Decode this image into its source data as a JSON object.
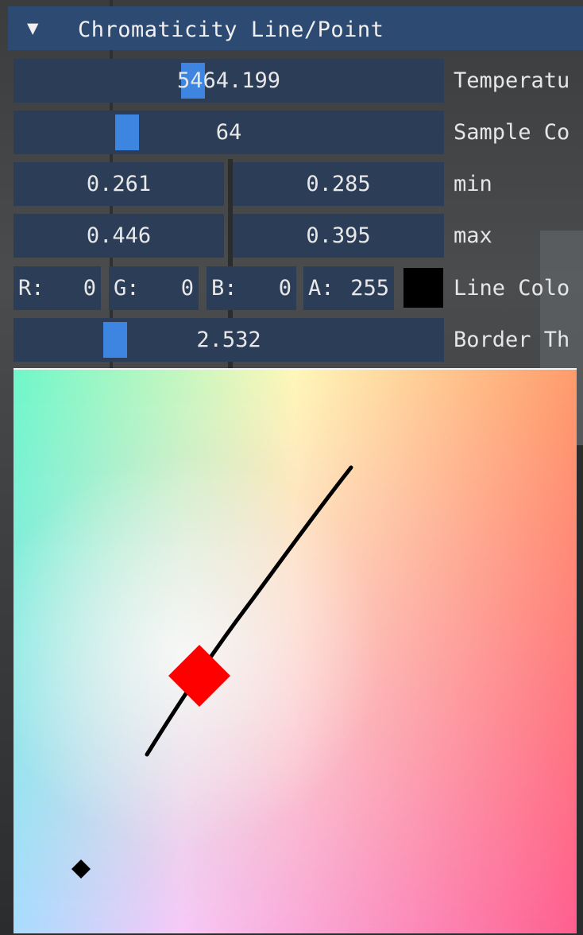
{
  "panel": {
    "collapse_arrow": "▼",
    "title": "Chromaticity Line/Point"
  },
  "temperature": {
    "value": "5464.199",
    "label": "Temperatu"
  },
  "sample_count": {
    "value": "64",
    "label": "Sample Co"
  },
  "min": {
    "x": "0.261",
    "y": "0.285",
    "label": "min"
  },
  "max": {
    "x": "0.446",
    "y": "0.395",
    "label": "max"
  },
  "line_color": {
    "r_key": "R:",
    "r": "0",
    "g_key": "G:",
    "g": "0",
    "b_key": "B:",
    "b": "0",
    "a_key": "A:",
    "a": "255",
    "swatch_color": "#000000",
    "label": "Line Colo"
  },
  "border_thickness": {
    "value": "2.532",
    "label": "Border Th"
  },
  "colors": {
    "accent": "#3d85e0",
    "header_bg": "#2d4a73",
    "field_bg": "#2c3d57",
    "point_marker": "#ff0000",
    "line": "#000000"
  },
  "icons": {
    "collapse": "triangle-down-icon",
    "point": "red-diamond-marker",
    "reference": "black-diamond-marker"
  }
}
